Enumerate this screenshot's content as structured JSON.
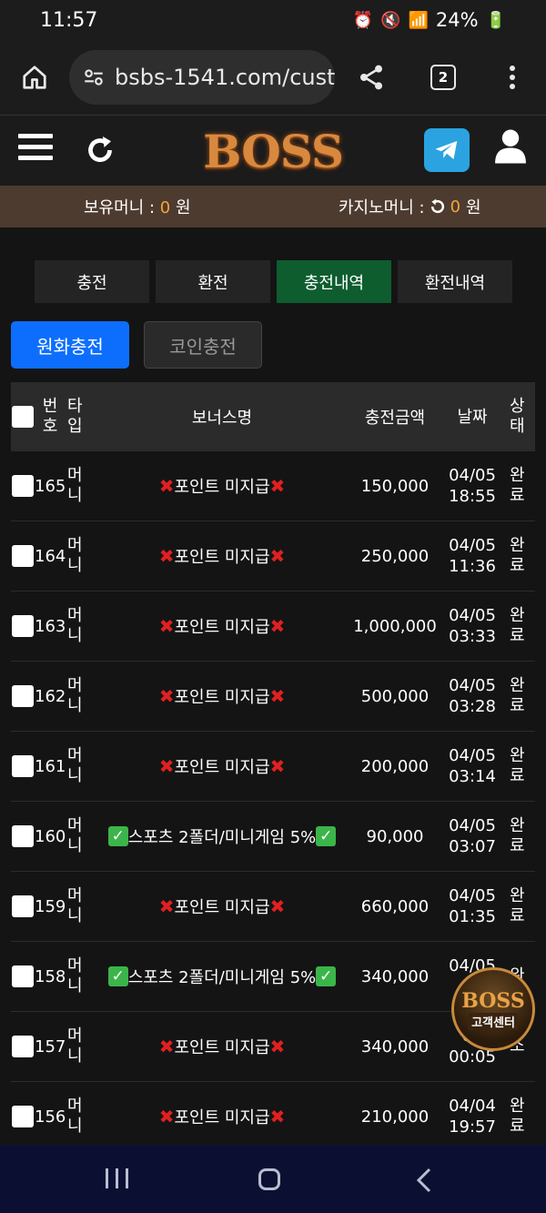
{
  "status_bar": {
    "time": "11:57",
    "battery": "24%"
  },
  "browser": {
    "url": "bsbs-1541.com/custo",
    "tab_count": "2"
  },
  "header": {
    "logo_text": "BOSS"
  },
  "money": {
    "holding_label": "보유머니 :",
    "holding_value": "0",
    "holding_unit": "원",
    "casino_label": "카지노머니 :",
    "casino_value": "0",
    "casino_unit": "원"
  },
  "tabs": [
    {
      "label": "충전"
    },
    {
      "label": "환전"
    },
    {
      "label": "충전내역"
    },
    {
      "label": "환전내역"
    }
  ],
  "subtabs": [
    {
      "label": "원화충전"
    },
    {
      "label": "코인충전"
    }
  ],
  "table": {
    "headers": {
      "no_1": "번",
      "no_2": "호",
      "type_1": "타",
      "type_2": "입",
      "bonus": "보너스명",
      "amount": "충전금액",
      "date": "날짜",
      "status_1": "상",
      "status_2": "태"
    },
    "rows": [
      {
        "no": "165",
        "type_1": "머",
        "type_2": "니",
        "bonus": "포인트 미지급",
        "bonus_kind": "x",
        "amount": "150,000",
        "date": "04/05",
        "time": "18:55",
        "status_1": "완",
        "status_2": "료"
      },
      {
        "no": "164",
        "type_1": "머",
        "type_2": "니",
        "bonus": "포인트 미지급",
        "bonus_kind": "x",
        "amount": "250,000",
        "date": "04/05",
        "time": "11:36",
        "status_1": "완",
        "status_2": "료"
      },
      {
        "no": "163",
        "type_1": "머",
        "type_2": "니",
        "bonus": "포인트 미지급",
        "bonus_kind": "x",
        "amount": "1,000,000",
        "date": "04/05",
        "time": "03:33",
        "status_1": "완",
        "status_2": "료"
      },
      {
        "no": "162",
        "type_1": "머",
        "type_2": "니",
        "bonus": "포인트 미지급",
        "bonus_kind": "x",
        "amount": "500,000",
        "date": "04/05",
        "time": "03:28",
        "status_1": "완",
        "status_2": "료"
      },
      {
        "no": "161",
        "type_1": "머",
        "type_2": "니",
        "bonus": "포인트 미지급",
        "bonus_kind": "x",
        "amount": "200,000",
        "date": "04/05",
        "time": "03:14",
        "status_1": "완",
        "status_2": "료"
      },
      {
        "no": "160",
        "type_1": "머",
        "type_2": "니",
        "bonus": "스포츠 2폴더/미니게임 5%",
        "bonus_kind": "check",
        "amount": "90,000",
        "date": "04/05",
        "time": "03:07",
        "status_1": "완",
        "status_2": "료"
      },
      {
        "no": "159",
        "type_1": "머",
        "type_2": "니",
        "bonus": "포인트 미지급",
        "bonus_kind": "x",
        "amount": "660,000",
        "date": "04/05",
        "time": "01:35",
        "status_1": "완",
        "status_2": "료"
      },
      {
        "no": "158",
        "type_1": "머",
        "type_2": "니",
        "bonus": "스포츠 2폴더/미니게임 5%",
        "bonus_kind": "check",
        "amount": "340,000",
        "date": "04/05",
        "time": "0",
        "status_1": "완",
        "status_2": ""
      },
      {
        "no": "157",
        "type_1": "머",
        "type_2": "니",
        "bonus": "포인트 미지급",
        "bonus_kind": "x",
        "amount": "340,000",
        "date": "04",
        "time": "00:05",
        "status_1": "",
        "status_2": "소"
      },
      {
        "no": "156",
        "type_1": "머",
        "type_2": "니",
        "bonus": "포인트 미지급",
        "bonus_kind": "x",
        "amount": "210,000",
        "date": "04/04",
        "time": "19:57",
        "status_1": "완",
        "status_2": "료"
      }
    ]
  },
  "floating_badge": {
    "logo": "BOSS",
    "label": "고객센터"
  },
  "icons": {
    "home": "home-icon",
    "tune": "tune-icon",
    "share": "share-icon",
    "more": "more-vert-icon",
    "menu": "hamburger-icon",
    "refresh": "refresh-icon",
    "telegram": "telegram-icon",
    "user": "user-icon",
    "casino_refresh": "rotate-icon"
  },
  "colors": {
    "accent_orange": "#f3a43a",
    "active_tab": "#0e5d2f",
    "primary_button": "#0d6efd",
    "money_bar": "#4e3b2f"
  }
}
